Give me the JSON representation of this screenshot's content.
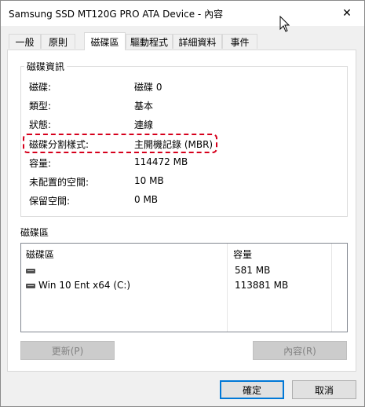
{
  "window": {
    "title": "Samsung SSD MT120G PRO ATA Device - 內容",
    "close_glyph": "✕"
  },
  "tabs": [
    {
      "label": "一般",
      "active": false
    },
    {
      "label": "原則",
      "active": false
    },
    {
      "label": "磁碟區",
      "active": true
    },
    {
      "label": "驅動程式",
      "active": false
    },
    {
      "label": "詳細資料",
      "active": false
    },
    {
      "label": "事件",
      "active": false
    }
  ],
  "disk_info": {
    "group_title": "磁碟資訊",
    "rows": [
      {
        "label": "磁碟:",
        "value": "磁碟 0"
      },
      {
        "label": "類型:",
        "value": "基本"
      },
      {
        "label": "狀態:",
        "value": "連線"
      },
      {
        "label": "磁碟分割樣式:",
        "value": "主開機記錄 (MBR)"
      },
      {
        "label": "容量:",
        "value": "114472 MB"
      },
      {
        "label": "未配置的空間:",
        "value": "10 MB"
      },
      {
        "label": "保留空間:",
        "value": "0 MB"
      }
    ],
    "highlight_color": "#d6001c"
  },
  "volumes": {
    "group_title": "磁碟區",
    "columns": [
      "磁碟區",
      "容量"
    ],
    "rows": [
      {
        "name": "",
        "capacity": "581 MB",
        "icon": "drive-icon"
      },
      {
        "name": "Win 10 Ent x64 (C:)",
        "capacity": "113881 MB",
        "icon": "drive-icon"
      }
    ],
    "update_button": "更新(P)",
    "properties_button": "內容(R)"
  },
  "footer": {
    "ok_button": "確定",
    "cancel_button": "取消"
  },
  "colors": {
    "accent": "#0078d7"
  }
}
